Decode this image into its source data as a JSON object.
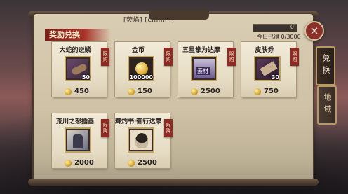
{
  "header": {
    "search_tag": "[荧焰] [emmm]",
    "rank_value": "0",
    "today_label": "今日已得 0/3000",
    "section_title": "奖励兑换",
    "close_label": "×"
  },
  "side_tabs": [
    {
      "label": "兑换",
      "active": true
    },
    {
      "label": "地域",
      "active": false
    }
  ],
  "colors": {
    "accent": "#8e2a24",
    "coin": "#d6a430"
  },
  "items": [
    {
      "title": "大蛇的逆鳞",
      "tag": "限购",
      "count": "50",
      "price": "450",
      "icon": "snake-scale-icon"
    },
    {
      "title": "金币",
      "tag": "限购",
      "count": "100000",
      "price": "150",
      "icon": "gold-coin-icon"
    },
    {
      "title": "五星拳为达摩",
      "tag": "限购",
      "count": "",
      "price": "2500",
      "icon": "daruma-icon"
    },
    {
      "title": "皮肤券",
      "tag": "限购",
      "count": "30",
      "price": "750",
      "icon": "skin-ticket-icon"
    },
    {
      "title": "荒川之怒插画",
      "tag": "限购",
      "count": "",
      "price": "2000",
      "icon": "illustration-icon"
    },
    {
      "title": "舞灼书·御行达摩",
      "tag": "限购",
      "count": "",
      "price": "2500",
      "icon": "dance-daruma-icon"
    }
  ]
}
